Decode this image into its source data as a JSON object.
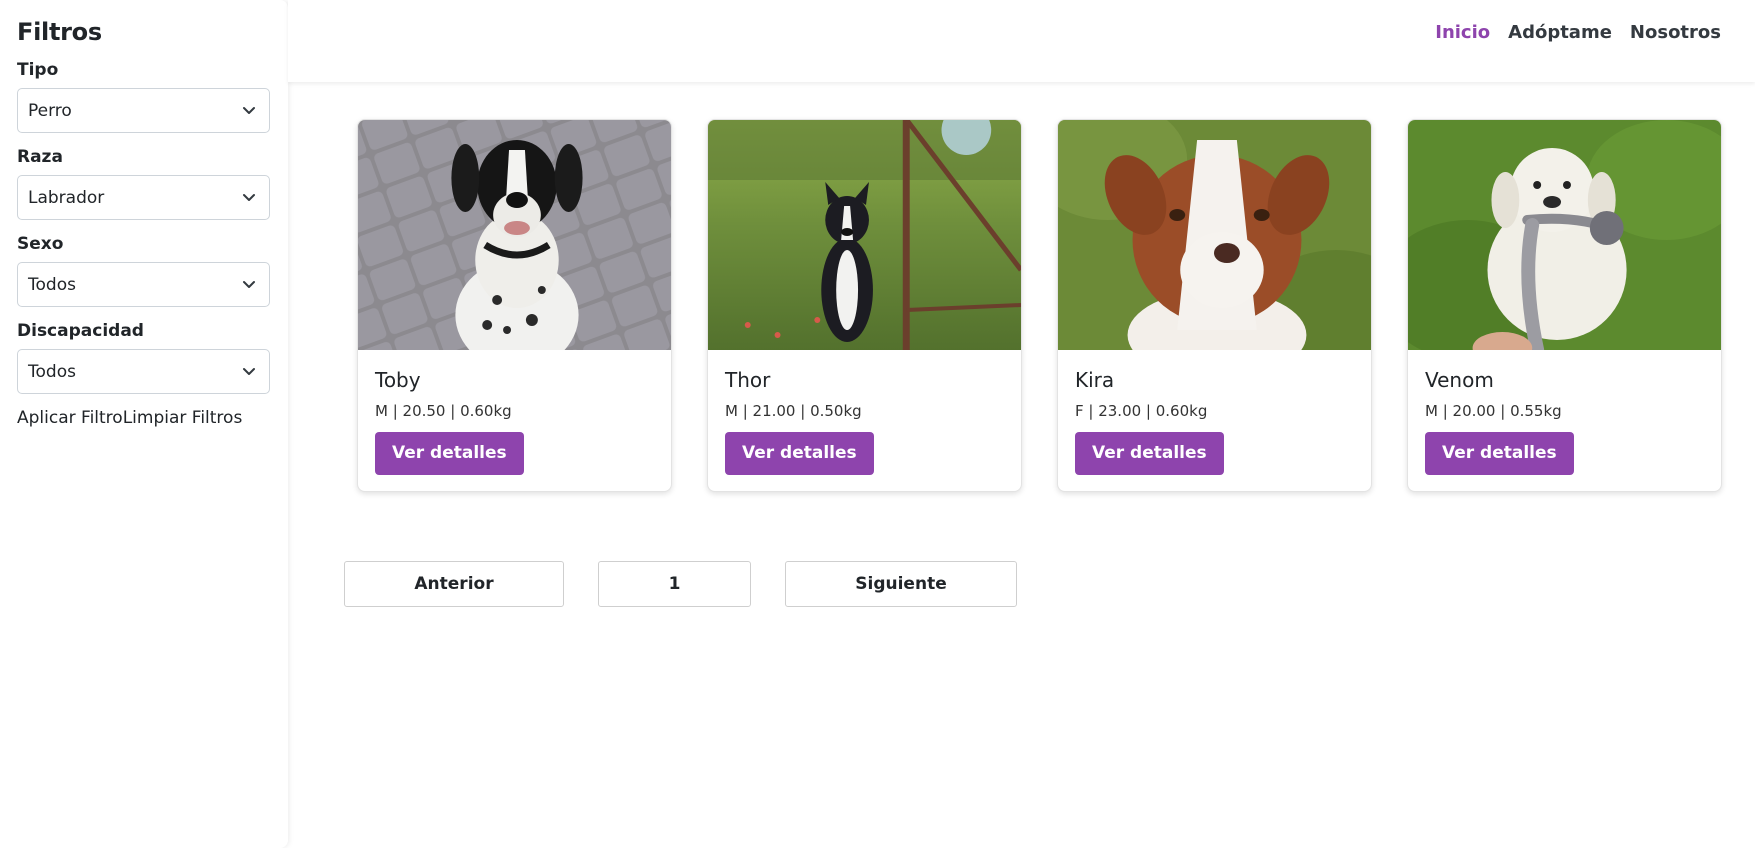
{
  "sidebar": {
    "title": "Filtros",
    "filters": [
      {
        "label": "Tipo",
        "value": "Perro"
      },
      {
        "label": "Raza",
        "value": "Labrador"
      },
      {
        "label": "Sexo",
        "value": "Todos"
      },
      {
        "label": "Discapacidad",
        "value": "Todos"
      }
    ],
    "apply_label": "Aplicar Filtro",
    "clear_label": "Limpiar Filtros"
  },
  "nav": {
    "items": [
      "Inicio",
      "Adóptame",
      "Nosotros"
    ],
    "active": "Inicio",
    "accent": "#8e44ad"
  },
  "cards": [
    {
      "name": "Toby",
      "meta": "M | 20.50 | 0.60kg",
      "button": "Ver detalles"
    },
    {
      "name": "Thor",
      "meta": "M | 21.00 | 0.50kg",
      "button": "Ver detalles"
    },
    {
      "name": "Kira",
      "meta": "F | 23.00 | 0.60kg",
      "button": "Ver detalles"
    },
    {
      "name": "Venom",
      "meta": "M | 20.00 | 0.55kg",
      "button": "Ver detalles"
    }
  ],
  "pagination": {
    "prev_label": "Anterior",
    "current_page": "1",
    "next_label": "Siguiente"
  }
}
